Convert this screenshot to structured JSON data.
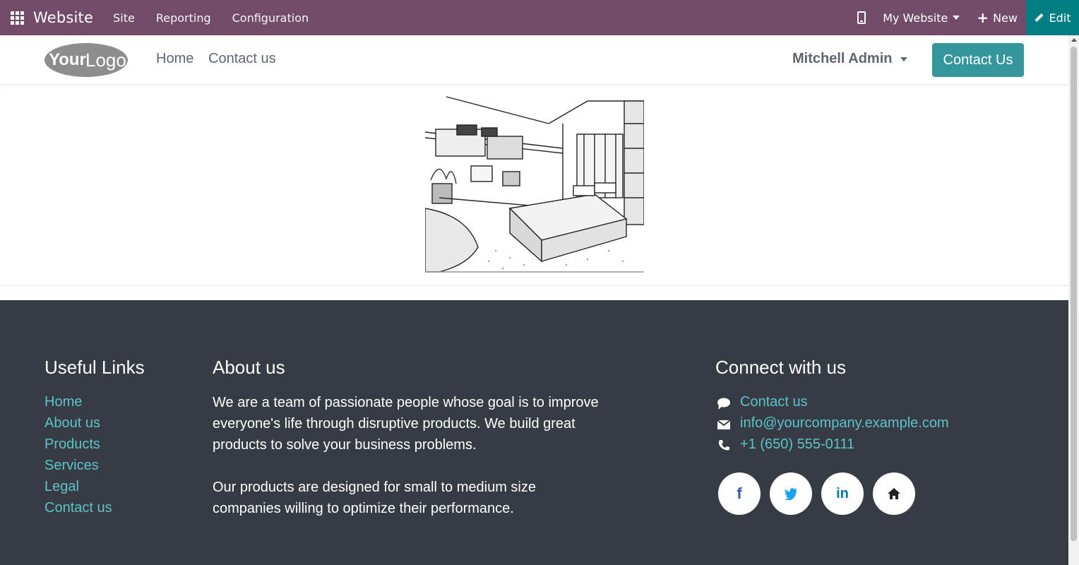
{
  "topbar": {
    "brand": "Website",
    "menu": [
      "Site",
      "Reporting",
      "Configuration"
    ],
    "my_website": "My Website",
    "new_label": "New",
    "edit_label": "Edit",
    "bg_color": "#714b67",
    "edit_color": "#017e84"
  },
  "header": {
    "nav": [
      "Home",
      "Contact us"
    ],
    "user": "Mitchell Admin",
    "contact_button": "Contact Us",
    "accent": "#35979c"
  },
  "logo": {
    "text_bold": "Your",
    "text_light": "Logo"
  },
  "footer": {
    "useful_links": {
      "title": "Useful Links",
      "items": [
        "Home",
        "About us",
        "Products",
        "Services",
        "Legal",
        "Contact us"
      ]
    },
    "about": {
      "title": "About us",
      "lines_p1": [
        "We are a team of passionate people whose goal is to improve",
        "everyone's life through disruptive products. We build great",
        "products to solve your business problems."
      ],
      "lines_p2": [
        "Our products are designed for small to medium size",
        "companies willing to optimize their performance."
      ]
    },
    "connect": {
      "title": "Connect with us",
      "contact": "Contact us",
      "email": "info@yourcompany.example.com",
      "phone": "+1 (650) 555-0111"
    },
    "social": [
      "facebook-icon",
      "twitter-icon",
      "linkedin-icon",
      "home-icon"
    ],
    "bg_color": "#363b44",
    "link_color": "#5cc4c8"
  }
}
